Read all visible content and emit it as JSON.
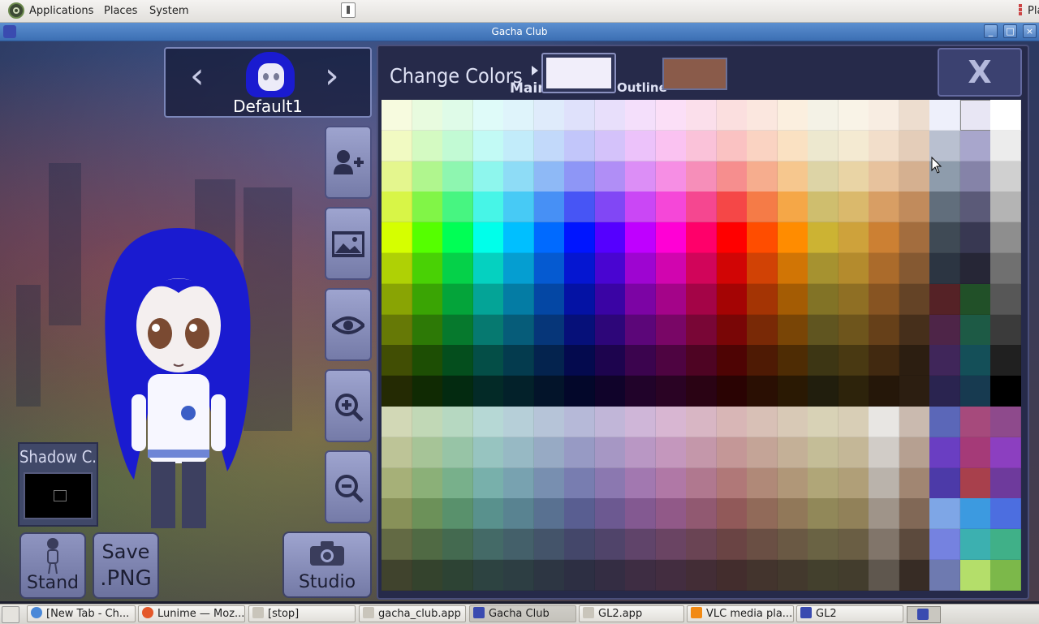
{
  "top_panel": {
    "menus": [
      "Applications",
      "Places",
      "System"
    ],
    "tray_right_label": "Places"
  },
  "window": {
    "title": "Gacha Club",
    "controls": [
      "minimize",
      "maximize",
      "close"
    ]
  },
  "character": {
    "name": "Default1",
    "hair_color": "#1a1bd0"
  },
  "side_buttons": [
    "add-person-icon",
    "image-icon",
    "eye-icon",
    "zoom-in-icon",
    "zoom-out-icon"
  ],
  "shadow": {
    "label": "Shadow C."
  },
  "bottom_buttons": {
    "stand_label": "Stand",
    "save_line1": "Save",
    "save_line2": ".PNG",
    "studio_label": "Studio"
  },
  "color_panel": {
    "title": "Change Colors",
    "main_label": "Main",
    "outline_label": "Outline",
    "main_color": "#f1eefa",
    "outline_color": "#8a5b4a",
    "close_label": "X"
  },
  "taskbar": {
    "tasks": [
      {
        "label": "[New Tab - Ch...",
        "icon": "chrome-icon"
      },
      {
        "label": "Lunime — Moz...",
        "icon": "firefox-icon"
      },
      {
        "label": "[stop]",
        "icon": "folder-icon"
      },
      {
        "label": "gacha_club.app",
        "icon": "folder-icon"
      },
      {
        "label": "Gacha Club",
        "icon": "gacha-icon"
      },
      {
        "label": "GL2.app",
        "icon": "folder-icon"
      },
      {
        "label": "VLC media pla...",
        "icon": "vlc-icon"
      },
      {
        "label": "GL2",
        "icon": "gacha-icon"
      }
    ]
  }
}
